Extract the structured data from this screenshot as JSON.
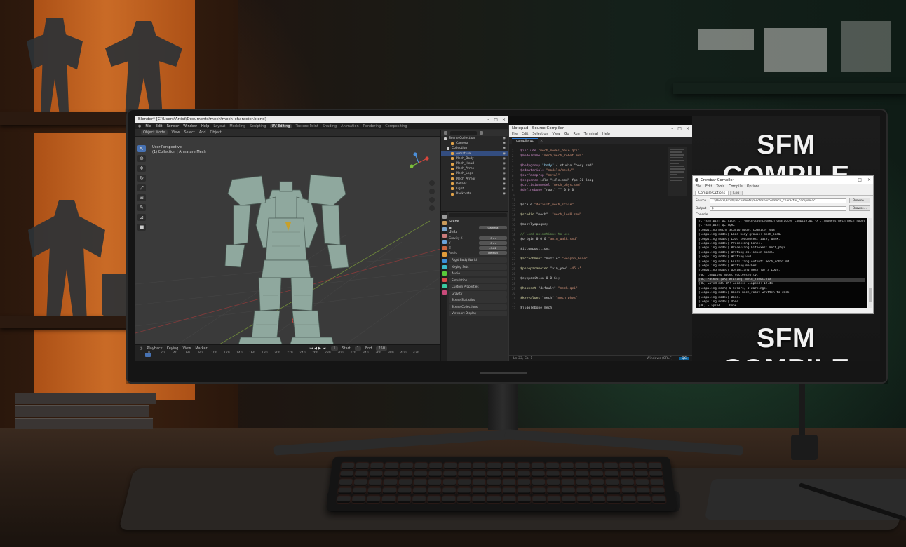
{
  "scene": {
    "brand_colors": {
      "shelf_glow": "#e3782a",
      "wall_green": "#1f5a3c"
    }
  },
  "blender": {
    "title": "Blender* [C:\\Users\\Artist\\Documents\\mech\\mech_character.blend]",
    "menu": [
      "File",
      "Edit",
      "Render",
      "Window",
      "Help"
    ],
    "workspaces": [
      "Layout",
      "Modeling",
      "Sculpting",
      "UV Editing",
      "Texture Paint",
      "Shading",
      "Animation",
      "Rendering",
      "Compositing",
      "Scripting"
    ],
    "active_workspace": "Layout",
    "header": [
      "Object Mode",
      "View",
      "Select",
      "Add",
      "Object"
    ],
    "viewport_info": [
      "User Perspective",
      "(1) Collection | Armature Mech"
    ],
    "tools": [
      "cursor-icon",
      "move-icon",
      "rotate-icon",
      "scale-icon",
      "transform-icon",
      "annotate-icon",
      "measure-icon",
      "add-cube-icon"
    ],
    "outliner": {
      "items": [
        {
          "label": "Scene Collection",
          "type": "coll"
        },
        {
          "label": "Camera",
          "type": "obj"
        },
        {
          "label": "Collection",
          "type": "coll"
        },
        {
          "label": "Armature",
          "type": "obj",
          "selected": true
        },
        {
          "label": "Mech_Body",
          "type": "obj"
        },
        {
          "label": "Mech_Head",
          "type": "obj"
        },
        {
          "label": "Mech_Arms",
          "type": "obj"
        },
        {
          "label": "Mech_Legs",
          "type": "obj"
        },
        {
          "label": "Mech_Armor",
          "type": "obj"
        },
        {
          "label": "Details",
          "type": "obj"
        },
        {
          "label": "Light",
          "type": "obj"
        },
        {
          "label": "Backplate",
          "type": "obj"
        }
      ]
    },
    "properties": {
      "title": "Scene",
      "camera": "Camera",
      "units_header": "Units",
      "fields": [
        {
          "label": "Gravity X",
          "value": "0 m"
        },
        {
          "label": "Y",
          "value": "0 m"
        },
        {
          "label": "Z",
          "value": "-9.81"
        }
      ],
      "sound_label": "Audio",
      "sound_value": "Default",
      "sections": [
        "Rigid Body World",
        "Keying Sets",
        "Audio",
        "Simulation",
        "Custom Properties",
        "Gravity",
        "Scene Statistics",
        "Scene Collections",
        "Viewport Display"
      ]
    },
    "timeline": {
      "controls": [
        "Playback",
        "Keying",
        "View",
        "Marker"
      ],
      "start": "Start",
      "start_val": "1",
      "end": "End",
      "end_val": "250",
      "ruler": [
        "0",
        "20",
        "40",
        "60",
        "80",
        "100",
        "120",
        "140",
        "160",
        "180",
        "200",
        "220",
        "240",
        "260",
        "280",
        "300",
        "320",
        "340",
        "360",
        "380",
        "400",
        "420"
      ]
    }
  },
  "editor": {
    "title": "Notepad - Source Compiler",
    "menu": [
      "File",
      "Edit",
      "Selection",
      "View",
      "Go",
      "Run",
      "Terminal",
      "Help"
    ],
    "tab": "compile.qc",
    "lines": [
      [
        {
          "c": "kw",
          "t": "$include "
        },
        {
          "c": "str",
          "t": "\"mech_model_base.qci\""
        }
      ],
      [
        {
          "c": "kw",
          "t": "$modelname "
        },
        {
          "c": "str",
          "t": "\"mech/mech_robot.mdl\""
        }
      ],
      [],
      [
        {
          "c": "kw",
          "t": "$bodygroup "
        },
        {
          "c": "ty",
          "t": "\"body\""
        },
        {
          "c": "tx",
          "t": " { studio \"body.smd\""
        }
      ],
      [
        {
          "c": "kw",
          "t": "$cdmaterials "
        },
        {
          "c": "str",
          "t": "\"models/mech/\""
        }
      ],
      [
        {
          "c": "kw",
          "t": "$surfaceprop "
        },
        {
          "c": "str",
          "t": "\"metal\""
        }
      ],
      [
        {
          "c": "kw",
          "t": "$sequence "
        },
        {
          "c": "tx",
          "t": "idle \"idle.smd\" fps 30 loop"
        }
      ],
      [
        {
          "c": "kw",
          "t": "$collisionmodel "
        },
        {
          "c": "str",
          "t": "\"mech_phys.smd\""
        }
      ],
      [
        {
          "c": "kw",
          "t": "$definebone "
        },
        {
          "c": "tx",
          "t": "\"root\" \"\" 0 0 0"
        }
      ],
      [],
      [],
      [
        {
          "c": "tx",
          "t": "$scale "
        },
        {
          "c": "str",
          "t": "\"default_mech_scale\""
        }
      ],
      [],
      [
        {
          "c": "fn",
          "t": "$studio"
        },
        {
          "c": "tx",
          "t": " \"mech\"  "
        },
        {
          "c": "str",
          "t": "\"mech_lod0.smd\""
        }
      ],
      [],
      [
        {
          "c": "tx",
          "t": "$mostlyopaque;"
        }
      ],
      [],
      [
        {
          "c": "gr",
          "t": "// load animations to use"
        }
      ],
      [
        {
          "c": "tx",
          "t": "$origin 0 0 0 "
        },
        {
          "c": "str",
          "t": "\"anim_walk.smd\""
        }
      ],
      [],
      [
        {
          "c": "tx",
          "t": "$illumposition;"
        }
      ],
      [],
      [
        {
          "c": "fn",
          "t": "$attachment"
        },
        {
          "c": "tx",
          "t": " \"muzzle\" "
        },
        {
          "c": "str",
          "t": "\"weapon_bone\""
        }
      ],
      [],
      [
        {
          "c": "fn",
          "t": "$poseparameter"
        },
        {
          "c": "tx",
          "t": " \"aim_yaw\" "
        },
        {
          "c": "str",
          "t": "-45 45"
        }
      ],
      [],
      [
        {
          "c": "tx",
          "t": "$eyeposition 0 0 64;"
        }
      ],
      [],
      [
        {
          "c": "fn",
          "t": "$hboxset"
        },
        {
          "c": "tx",
          "t": " \"default\" "
        },
        {
          "c": "str",
          "t": "\"mech.qci\""
        }
      ],
      [],
      [
        {
          "c": "fn",
          "t": "$keyvalues"
        },
        {
          "c": "tx",
          "t": " \"mech\" "
        },
        {
          "c": "str",
          "t": "\"mech_phys\""
        }
      ],
      [],
      [
        {
          "c": "tx",
          "t": "$jigglebone mech;"
        }
      ]
    ],
    "status_left": "Ln 33, Col 1",
    "status_right": "Windows (CRLF)",
    "status_chip": "QC"
  },
  "right_panel": {
    "title_top": "SFM COMPILE",
    "title_bottom": "SFM COMPILE",
    "compiler": {
      "title": "Crowbar Compiler",
      "menu": [
        "File",
        "Edit",
        "Tools",
        "Compile",
        "Options"
      ],
      "tabs": [
        "Compile Options",
        "Log"
      ],
      "source_label": "Source",
      "source_value": "C:\\Users\\Artist\\Documents\\mech\\source\\mech_character_compile.qc",
      "source_btn": "Browse...",
      "target_label": "Output",
      "target_value": "$",
      "target_btn": "Browse...",
      "output_label": "Console",
      "console": [
        "[C:\\sfm\\bin] Qc file: ...\\mech\\source\\mech_character_compile.qc -> ../models/mech/mech_robot.mdl",
        "[C:\\sfm\\bin] QC TQRC",
        "[compiling mech] Studio model compiler v48",
        "[Compiling model] Load body groups: mech_lod0.",
        "[Compiling model] Load sequences: idle, walk.",
        "[Compiling model] Processing bones.",
        "[Compiling model] Processing hitboxes: mech_phys.",
        "[Compiling model] Writing collision model.",
        "[Compiling model] Writing vvd.",
        "[Compiling model] Finalizing output: mech_robot.mdl.",
        "[Compiling model] Writing meshes.",
        "[Compiling model] Optimizing mesh for 3 LODs.",
        "[OK] Compiled model successfully.",
        "[OK]  Packed  [OK]   Writing: mech_robot.vtx",
        "[OK] Saved mdl  OK!  Success  Elapsed: 12.4s",
        "[Compiling mech] 0 errors, 0 warnings.",
        "[Compiling model] model mech_robot written to disk.",
        "[Compiling model]  Done.",
        "[Compiling model]  Done.",
        "[OK]  Elapsed  ...  Done.",
        "[C:\\sfm\\bin] Press any key to continue..._"
      ]
    }
  }
}
